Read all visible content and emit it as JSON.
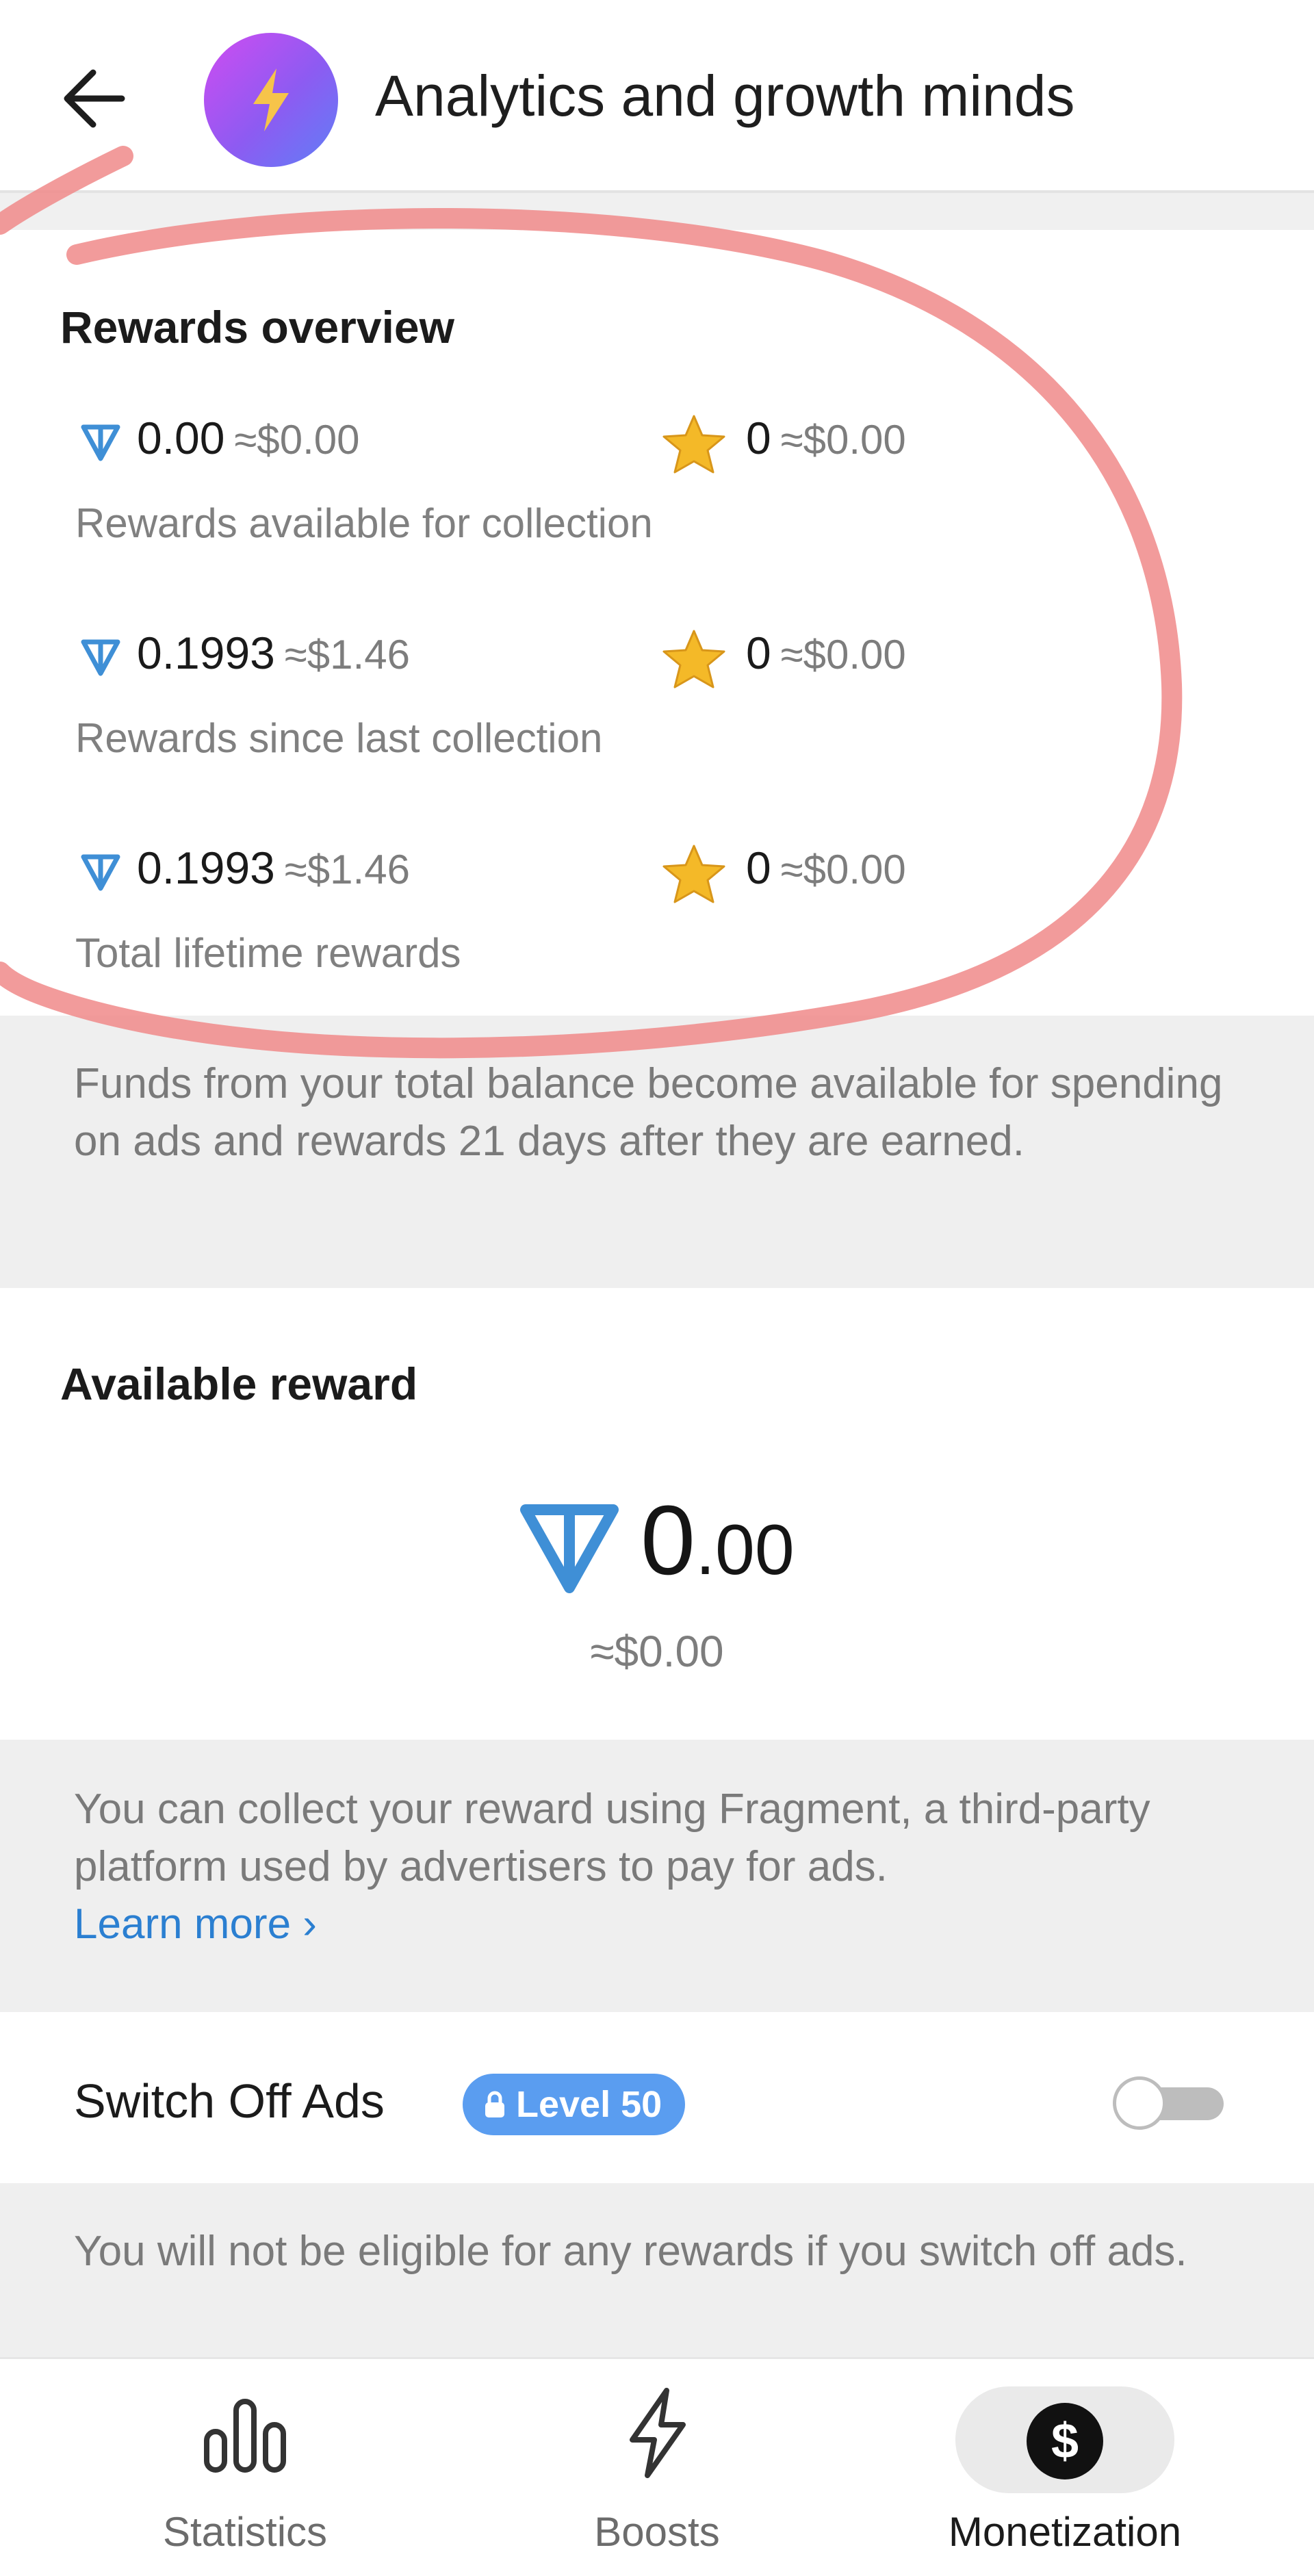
{
  "header": {
    "title": "Analytics and growth minds",
    "back_icon": "back-arrow-icon",
    "avatar_icon": "lightning-icon"
  },
  "rewards_overview": {
    "heading": "Rewards overview",
    "rows": [
      {
        "ton": "0.00",
        "ton_usd": "≈$0.00",
        "stars": "0",
        "stars_usd": "≈$0.00",
        "label": "Rewards available for collection"
      },
      {
        "ton": "0.1993",
        "ton_usd": "≈$1.46",
        "stars": "0",
        "stars_usd": "≈$0.00",
        "label": "Rewards since last collection"
      },
      {
        "ton": "0.1993",
        "ton_usd": "≈$1.46",
        "stars": "0",
        "stars_usd": "≈$0.00",
        "label": "Total lifetime rewards"
      }
    ],
    "note": "Funds from your total balance become available for spending on ads and rewards 21 days after they are earned."
  },
  "available_reward": {
    "heading": "Available reward",
    "amount_int": "0",
    "amount_dec": ".00",
    "usd": "≈$0.00",
    "note": "You can collect your reward using Fragment, a third-party platform used by advertisers to pay for ads.",
    "learn_more": "Learn more ›"
  },
  "switch_off_ads": {
    "label": "Switch Off Ads",
    "badge": "Level 50",
    "toggle_on": false,
    "note": "You will not be eligible for any rewards if you switch off ads."
  },
  "nav": {
    "items": [
      {
        "label": "Statistics",
        "icon": "bar-chart-icon"
      },
      {
        "label": "Boosts",
        "icon": "lightning-outline-icon"
      },
      {
        "label": "Monetization",
        "icon": "dollar-circle-icon"
      }
    ],
    "active": "Monetization"
  },
  "colors": {
    "ton_blue": "#3f8fd6",
    "star_gold": "#f4b928",
    "badge_blue": "#5a9df0",
    "link_blue": "#2b7fd1",
    "annotation_red": "#f08a8a"
  }
}
